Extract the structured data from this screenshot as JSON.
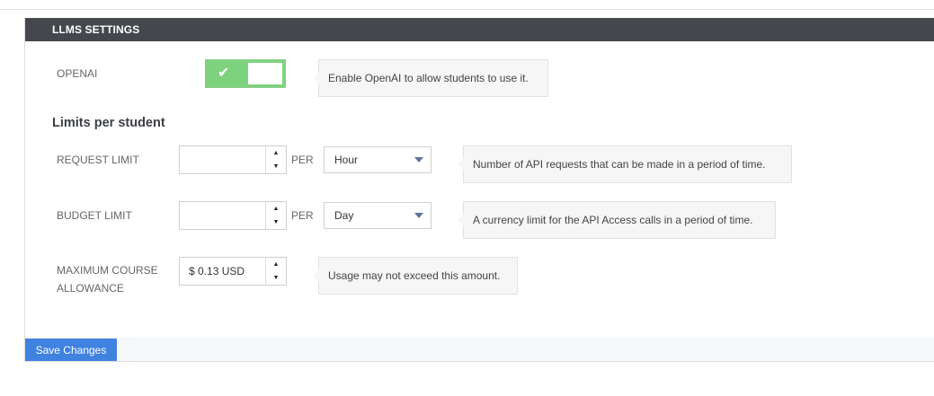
{
  "panel": {
    "title": "LLMS SETTINGS"
  },
  "openai": {
    "label": "OPENAI",
    "enabled": true,
    "help": "Enable OpenAI to allow students to use it."
  },
  "limits": {
    "heading": "Limits per student",
    "request_limit": {
      "label": "REQUEST LIMIT",
      "value": "",
      "per_label": "PER",
      "period": "Hour",
      "help": "Number of API requests that can be made in a period of time."
    },
    "budget_limit": {
      "label": "BUDGET LIMIT",
      "value": "",
      "per_label": "PER",
      "period": "Day",
      "help": "A currency limit for the API Access calls in a period of time."
    },
    "max_course_allowance": {
      "label_line1": "MAXIMUM COURSE",
      "label_line2": "ALLOWANCE",
      "value": "$ 0.13 USD",
      "help": "Usage may not exceed this amount."
    }
  },
  "footer": {
    "save_label": "Save Changes"
  },
  "colors": {
    "header_bg": "#44474c",
    "toggle_on": "#7dd37d",
    "save_button": "#3f82e0"
  },
  "icons": {
    "toggle": "check-icon",
    "spin_up": "arrow-up-icon",
    "spin_down": "arrow-down-icon",
    "select": "caret-down-icon"
  }
}
